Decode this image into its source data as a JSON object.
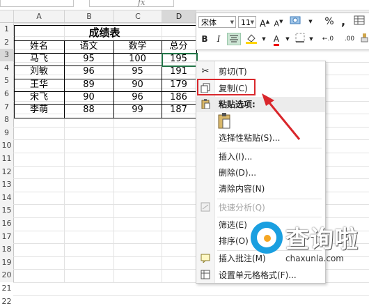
{
  "formula_bar": {
    "fx": "fx"
  },
  "columns": [
    "A",
    "B",
    "C",
    "D"
  ],
  "rows": [
    "1",
    "2",
    "3",
    "4",
    "5",
    "6",
    "7",
    "8",
    "9",
    "10",
    "11",
    "12",
    "13",
    "14",
    "15",
    "16",
    "17",
    "18",
    "19",
    "20",
    "21",
    "22"
  ],
  "sheet": {
    "title": "成绩表",
    "headers": [
      "姓名",
      "语文",
      "数学",
      "总分"
    ],
    "records": [
      [
        "马飞",
        "95",
        "100",
        "195"
      ],
      [
        "刘敏",
        "96",
        "95",
        "191"
      ],
      [
        "王华",
        "89",
        "90",
        "179"
      ],
      [
        "宋飞",
        "90",
        "96",
        "186"
      ],
      [
        "李萌",
        "88",
        "99",
        "187"
      ]
    ]
  },
  "mini_toolbar": {
    "font": "宋体",
    "size": "11",
    "grow_font": "A",
    "shrink_font": "A",
    "percent": "%",
    "comma": ",",
    "bold": "B",
    "italic": "I",
    "font_color": "A",
    "increase_decimal": "←.0",
    "decrease_decimal": ".00"
  },
  "context_menu": {
    "items": [
      {
        "label": "剪切(T)",
        "icon": "scissors-icon",
        "disabled": false
      },
      {
        "label": "复制(C)",
        "icon": "copy-icon",
        "disabled": false
      },
      {
        "label": "粘贴选项:",
        "icon": "paste-icon",
        "disabled": false,
        "header": true
      },
      {
        "label": "选择性粘贴(S)...",
        "icon": "",
        "disabled": false
      },
      {
        "label": "插入(I)...",
        "icon": "",
        "disabled": false
      },
      {
        "label": "删除(D)...",
        "icon": "",
        "disabled": false
      },
      {
        "label": "清除内容(N)",
        "icon": "",
        "disabled": false
      },
      {
        "label": "快速分析(Q)",
        "icon": "quick-analysis-icon",
        "disabled": true
      },
      {
        "label": "筛选(E)",
        "icon": "",
        "disabled": false
      },
      {
        "label": "排序(O)",
        "icon": "",
        "disabled": false
      },
      {
        "label": "插入批注(M)",
        "icon": "comment-icon",
        "disabled": false
      },
      {
        "label": "设置单元格格式(F)...",
        "icon": "format-cells-icon",
        "disabled": false
      }
    ]
  },
  "watermark": {
    "brand": "查询啦",
    "url": "chaxunla.com"
  },
  "colors": {
    "accent": "#217346",
    "highlight": "#d9262b",
    "brand": "#1a9fe0"
  }
}
